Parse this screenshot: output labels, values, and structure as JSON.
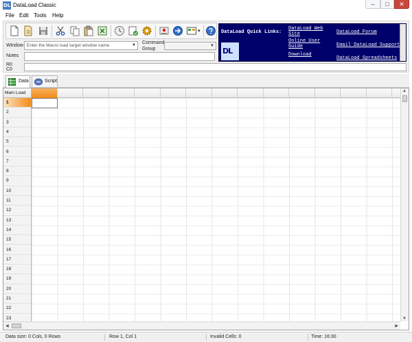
{
  "window": {
    "title": "DataLoad Classic",
    "icon_text": "DL",
    "controls": {
      "minimize": "–",
      "maximize": "□",
      "close": "✕"
    }
  },
  "menu": [
    "File",
    "Edit",
    "Tools",
    "Help"
  ],
  "toolbar": {
    "buttons": [
      "new-file-icon",
      "open-folder-icon",
      "save-icon",
      "cut-icon",
      "copy-icon",
      "paste-icon",
      "export-icon",
      "clock-icon",
      "checklist-icon",
      "gear-icon",
      "record-icon",
      "run-arrow-icon",
      "window-picker-icon",
      "help-icon"
    ]
  },
  "form": {
    "window_label": "Window",
    "window_placeholder": "Enter the Macro load target window name",
    "command_group_label": "Command Group",
    "notes_label": "Notes",
    "r0_label": "R0",
    "c0_label": "C0"
  },
  "quick_links": {
    "title": "DataLoad Quick Links:",
    "logo_text": "DL",
    "links": [
      "DataLoad Web Site",
      "Online User Guide",
      "Download",
      "DataLoad Forum",
      "Email DataLoad Support",
      "DataLoad Spreadsheets"
    ]
  },
  "tabs": [
    {
      "label": "Data",
      "icon": "spreadsheet-icon",
      "active": true
    },
    {
      "label": "Script",
      "icon": "script-icon",
      "active": false
    }
  ],
  "grid": {
    "corner_label": "Main Load",
    "row_numbers": [
      "1",
      "2",
      "3",
      "4",
      "5",
      "6",
      "7",
      "8",
      "9",
      "10",
      "11",
      "12",
      "13",
      "14",
      "15",
      "16",
      "17",
      "18",
      "19",
      "20",
      "21",
      "22",
      "23"
    ],
    "selected_row": "1",
    "selected_column_index": 0
  },
  "status": {
    "data_size": "Data size: 0 Cols, 0 Rows",
    "position": "Row 1, Col 1",
    "invalid": "Invalid Cells: 0",
    "time": "Time: 16:30"
  },
  "colors": {
    "selection_orange": "#F28B17",
    "links_panel_bg": "#00006B",
    "close_button": "#C9463D"
  }
}
